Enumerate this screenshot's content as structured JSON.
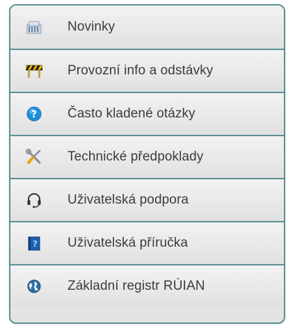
{
  "menu": {
    "items": [
      {
        "label": "Novinky",
        "icon": "newspaper-icon"
      },
      {
        "label": "Provozní info a odstávky",
        "icon": "roadblock-icon"
      },
      {
        "label": "Často kladené otázky",
        "icon": "help-icon"
      },
      {
        "label": "Technické předpoklady",
        "icon": "tools-icon"
      },
      {
        "label": "Uživatelská podpora",
        "icon": "headset-icon"
      },
      {
        "label": "Uživatelská příručka",
        "icon": "manual-icon"
      },
      {
        "label": "Základní registr RÚIAN",
        "icon": "globe-icon"
      }
    ]
  },
  "colors": {
    "border": "#5b8f94",
    "text": "#3c3c3c",
    "help_blue": "#1f8fd8"
  }
}
